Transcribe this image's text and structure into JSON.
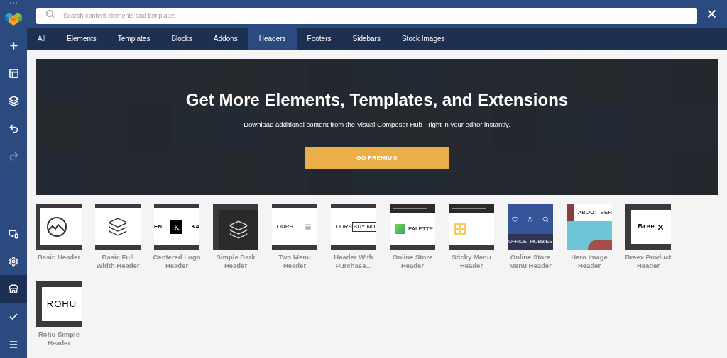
{
  "search": {
    "placeholder": "Search content elements and templates"
  },
  "tabs": [
    {
      "label": "All",
      "selected": false
    },
    {
      "label": "Elements",
      "selected": false
    },
    {
      "label": "Templates",
      "selected": false
    },
    {
      "label": "Blocks",
      "selected": false
    },
    {
      "label": "Addons",
      "selected": false
    },
    {
      "label": "Headers",
      "selected": true
    },
    {
      "label": "Footers",
      "selected": false
    },
    {
      "label": "Sidebars",
      "selected": false
    },
    {
      "label": "Stock Images",
      "selected": false
    }
  ],
  "sidebar": {
    "top_tools": [
      {
        "kind": "add",
        "disabled": false
      },
      {
        "kind": "layout",
        "disabled": false
      },
      {
        "kind": "layers",
        "disabled": false
      },
      {
        "kind": "undo",
        "disabled": false
      },
      {
        "kind": "redo",
        "disabled": true
      }
    ],
    "bottom_tools": [
      {
        "kind": "devices",
        "selected": false
      },
      {
        "kind": "settings",
        "selected": false
      },
      {
        "kind": "hub",
        "selected": true
      },
      {
        "kind": "publish",
        "selected": false
      },
      {
        "kind": "menu",
        "selected": false
      }
    ]
  },
  "banner": {
    "title": "Get More Elements, Templates, and Extensions",
    "subtitle": "Download additional content from the Visual Composer Hub - right in your editor instantly.",
    "button": "GO PREMIUM"
  },
  "templates": [
    {
      "name": "Basic Header",
      "kind": "basic"
    },
    {
      "name": "Basic Full Width Header",
      "kind": "full-width"
    },
    {
      "name": "Centered Logo Header",
      "kind": "centered-logo",
      "preview_texts": [
        "EN",
        "K",
        "KA"
      ]
    },
    {
      "name": "Simple Dark Header",
      "kind": "dark"
    },
    {
      "name": "Two Menu Header",
      "kind": "two-menu",
      "preview_texts": [
        "TOURS"
      ]
    },
    {
      "name": "Header With Purchase...",
      "kind": "purchase",
      "preview_texts": [
        "TOURS",
        "BUY NO"
      ]
    },
    {
      "name": "Online Store Header",
      "kind": "online-store",
      "preview_texts": [
        "PALETTE"
      ]
    },
    {
      "name": "Sticky Menu Header",
      "kind": "sticky"
    },
    {
      "name": "Online Store Menu Header",
      "kind": "store-menu",
      "preview_texts": [
        "OFFICE",
        "HOBBIES"
      ]
    },
    {
      "name": "Hero Image Header",
      "kind": "hero",
      "preview_texts": [
        "ABOUT",
        "SER"
      ]
    },
    {
      "name": "Breex Product Header",
      "kind": "breex",
      "preview_texts": [
        "Bree"
      ]
    },
    {
      "name": "Rohu Simple Header",
      "kind": "rohu",
      "preview_texts": [
        "ROHU"
      ]
    }
  ]
}
